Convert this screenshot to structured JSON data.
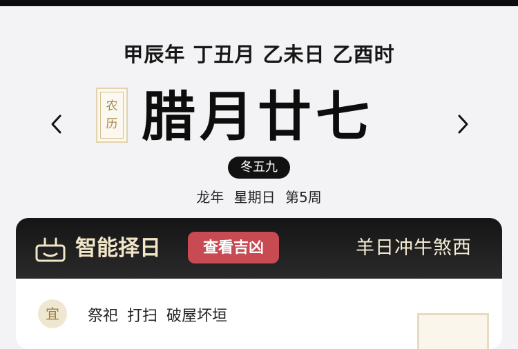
{
  "header": {
    "ganzhi": "甲辰年 丁丑月 乙未日 乙酉时",
    "seal_top": "农",
    "seal_bottom": "历",
    "lunar_date": "腊月廿七",
    "solar_term_badge": "冬五九",
    "week_info": "龙年 星期日 第5周",
    "prev_icon": "chevron-left",
    "next_icon": "chevron-right"
  },
  "card": {
    "title": "智能择日",
    "check_button": "查看吉凶",
    "clash_text": "羊日冲牛煞西",
    "icon": "calendar-tag-icon",
    "yi_label": "宜",
    "yi_items": "祭祀 打扫 破屋坏垣"
  },
  "watermark": "",
  "colors": {
    "accent_red": "#c84a52",
    "gold": "#f2e6c8",
    "seal_gold": "#a8894c",
    "dark": "#151515"
  }
}
